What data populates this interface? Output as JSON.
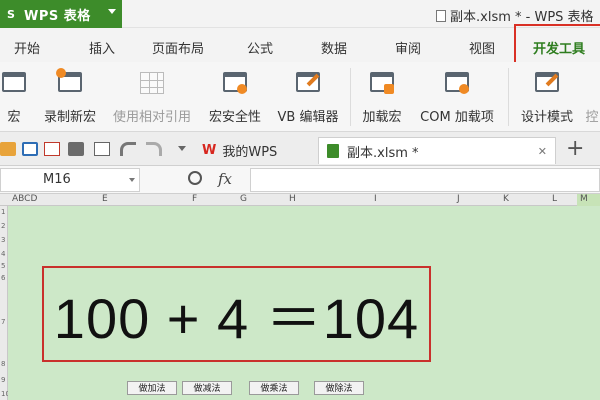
{
  "app": {
    "logo": "S",
    "name": "WPS 表格",
    "window_title": "副本.xlsm * - WPS 表格"
  },
  "menu": {
    "items": [
      "开始",
      "插入",
      "页面布局",
      "公式",
      "数据",
      "审阅",
      "视图",
      "开发工具"
    ],
    "active": "开发工具"
  },
  "ribbon": {
    "buttons": [
      {
        "label": "宏",
        "icon": "macro-window-icon"
      },
      {
        "label": "录制新宏",
        "icon": "record-macro-icon"
      },
      {
        "label": "使用相对引用",
        "icon": "relative-reference-grid-icon",
        "disabled": true
      },
      {
        "label": "宏安全性",
        "icon": "macro-security-icon"
      },
      {
        "label": "VB 编辑器",
        "icon": "vb-editor-icon"
      },
      {
        "label": "加载宏",
        "icon": "load-macro-icon"
      },
      {
        "label": "COM 加载项",
        "icon": "com-addin-icon"
      },
      {
        "label": "设计模式",
        "icon": "design-mode-icon"
      },
      {
        "label": "控",
        "icon": "control-icon"
      }
    ]
  },
  "tabs": {
    "home_tab": "我的WPS",
    "doc_tab": "副本.xlsm *",
    "close_glyph": "✕",
    "new_tab_glyph": "+"
  },
  "formula_bar": {
    "cell_ref": "M16",
    "fx_label": "fx",
    "value": ""
  },
  "columns": [
    "ABCD",
    "E",
    "F",
    "G",
    "H",
    "I",
    "J",
    "K",
    "L",
    "M"
  ],
  "rows": [
    "1",
    "2",
    "3",
    "4",
    "5",
    "6",
    "7",
    "8",
    "9",
    "10"
  ],
  "sheet": {
    "equation": "100 + 4 ＝104",
    "macro_buttons": [
      "做加法",
      "做减法",
      "做乘法",
      "做除法"
    ]
  },
  "colors": {
    "app_green": "#3d8c2a",
    "sheet_bg": "#cde8c8",
    "highlight_red": "#d93025"
  }
}
